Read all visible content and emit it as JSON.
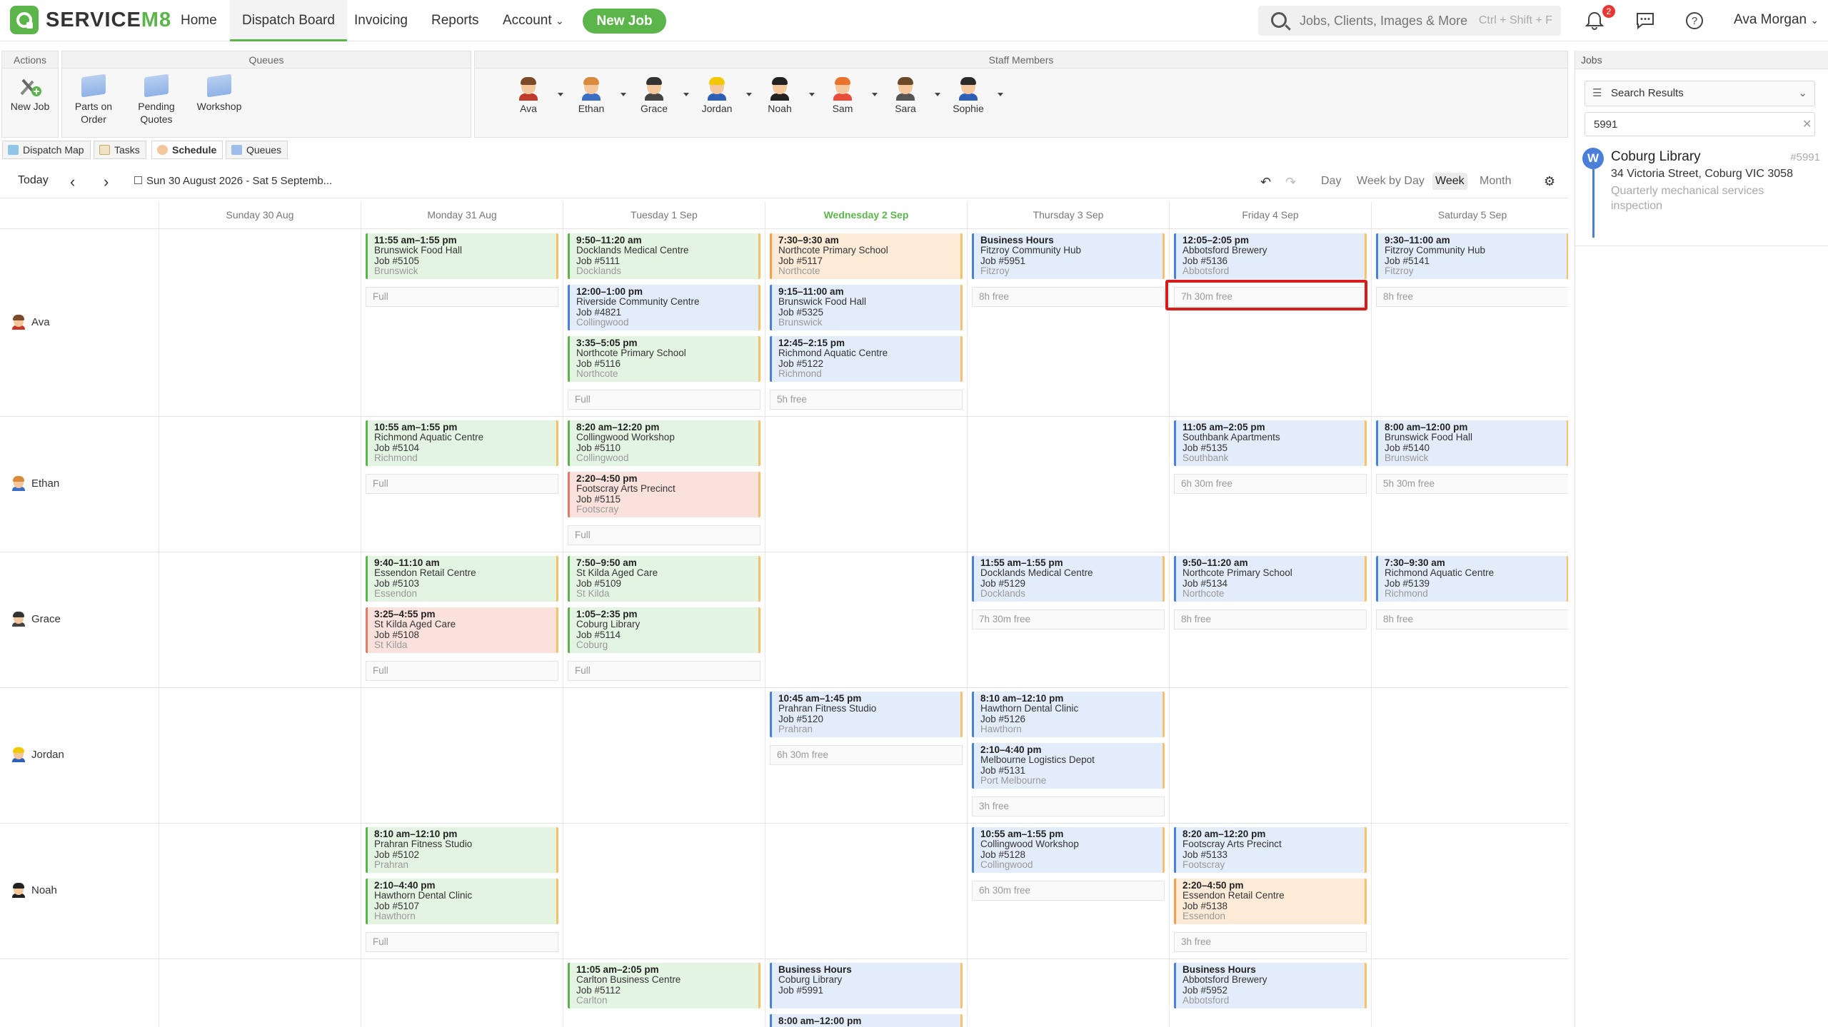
{
  "nav": {
    "brand": "SERVICE",
    "brand_suffix": "M8",
    "home": "Home",
    "dispatch_board": "Dispatch Board",
    "invoicing": "Invoicing",
    "reports": "Reports",
    "account": "Account",
    "new_job": "New Job",
    "search_placeholder": "Jobs, Clients, Images & More",
    "search_shortcut": "Ctrl + Shift + F",
    "notification_count": "2",
    "user_name": "Ava Morgan"
  },
  "toolbar": {
    "actions_title": "Actions",
    "new_job": "New Job",
    "queues_title": "Queues",
    "queues": [
      "Parts on Order",
      "Pending Quotes",
      "Workshop"
    ],
    "staff_title": "Staff Members",
    "staff": [
      "Ava",
      "Ethan",
      "Grace",
      "Jordan",
      "Noah",
      "Sam",
      "Sara",
      "Sophie"
    ]
  },
  "tabs": [
    "Dispatch Map",
    "Tasks",
    "Schedule",
    "Queues"
  ],
  "schedule": {
    "today": "Today",
    "date_range": "Sun 30 August 2026 - Sat 5 Septemb...",
    "views": [
      "Day",
      "Week by Day",
      "Week",
      "Month"
    ],
    "active_view": "Week",
    "days": [
      "Sunday 30 Aug",
      "Monday 31 Aug",
      "Tuesday 1 Sep",
      "Wednesday 2 Sep",
      "Thursday 3 Sep",
      "Friday 4 Sep",
      "Saturday 5 Sep"
    ],
    "today_index": 3,
    "rows": [
      {
        "name": "Ava",
        "cells": [
          {
            "day": 1,
            "jobs": [
              {
                "time": "11:55 am–1:55 pm",
                "client": "Brunswick Food Hall",
                "job": "Job #5105",
                "suburb": "Brunswick",
                "color": "green"
              }
            ],
            "free": "Full"
          },
          {
            "day": 2,
            "jobs": [
              {
                "time": "9:50–11:20 am",
                "client": "Docklands Medical Centre",
                "job": "Job #5111",
                "suburb": "Docklands",
                "color": "green"
              },
              {
                "time": "12:00–1:00 pm",
                "client": "Riverside Community Centre",
                "job": "Job #4821",
                "suburb": "Collingwood",
                "color": "blue"
              },
              {
                "time": "3:35–5:05 pm",
                "client": "Northcote Primary School",
                "job": "Job #5116",
                "suburb": "Northcote",
                "color": "green"
              }
            ],
            "free": "Full"
          },
          {
            "day": 3,
            "jobs": [
              {
                "time": "7:30–9:30 am",
                "client": "Northcote Primary School",
                "job": "Job #5117",
                "suburb": "Northcote",
                "color": "orange"
              },
              {
                "time": "9:15–11:00 am",
                "client": "Brunswick Food Hall",
                "job": "Job #5325",
                "suburb": "Brunswick",
                "color": "blue"
              },
              {
                "time": "12:45–2:15 pm",
                "client": "Richmond Aquatic Centre",
                "job": "Job #5122",
                "suburb": "Richmond",
                "color": "blue"
              }
            ],
            "free": "5h free"
          },
          {
            "day": 4,
            "jobs": [
              {
                "time": "Business Hours",
                "client": "Fitzroy Community Hub",
                "job": "Job #5951",
                "suburb": "Fitzroy",
                "color": "blue"
              }
            ],
            "free": "8h free"
          },
          {
            "day": 5,
            "jobs": [
              {
                "time": "12:05–2:05 pm",
                "client": "Abbotsford Brewery",
                "job": "Job #5136",
                "suburb": "Abbotsford",
                "color": "blue"
              }
            ],
            "free": "7h 30m free"
          },
          {
            "day": 6,
            "jobs": [
              {
                "time": "9:30–11:00 am",
                "client": "Fitzroy Community Hub",
                "job": "Job #5141",
                "suburb": "Fitzroy",
                "color": "blue"
              }
            ],
            "free": "8h free"
          }
        ]
      },
      {
        "name": "Ethan",
        "cells": [
          {
            "day": 1,
            "jobs": [
              {
                "time": "10:55 am–1:55 pm",
                "client": "Richmond Aquatic Centre",
                "job": "Job #5104",
                "suburb": "Richmond",
                "color": "green"
              }
            ],
            "free": "Full"
          },
          {
            "day": 2,
            "jobs": [
              {
                "time": "8:20 am–12:20 pm",
                "client": "Collingwood Workshop",
                "job": "Job #5110",
                "suburb": "Collingwood",
                "color": "green"
              },
              {
                "time": "2:20–4:50 pm",
                "client": "Footscray Arts Precinct",
                "job": "Job #5115",
                "suburb": "Footscray",
                "color": "red"
              }
            ],
            "free": "Full"
          },
          {
            "day": 5,
            "jobs": [
              {
                "time": "11:05 am–2:05 pm",
                "client": "Southbank Apartments",
                "job": "Job #5135",
                "suburb": "Southbank",
                "color": "blue"
              }
            ],
            "free": "6h 30m free"
          },
          {
            "day": 6,
            "jobs": [
              {
                "time": "8:00 am–12:00 pm",
                "client": "Brunswick Food Hall",
                "job": "Job #5140",
                "suburb": "Brunswick",
                "color": "blue"
              }
            ],
            "free": "5h 30m free"
          }
        ]
      },
      {
        "name": "Grace",
        "cells": [
          {
            "day": 1,
            "jobs": [
              {
                "time": "9:40–11:10 am",
                "client": "Essendon Retail Centre",
                "job": "Job #5103",
                "suburb": "Essendon",
                "color": "green"
              },
              {
                "time": "3:25–4:55 pm",
                "client": "St Kilda Aged Care",
                "job": "Job #5108",
                "suburb": "St Kilda",
                "color": "red"
              }
            ],
            "free": "Full"
          },
          {
            "day": 2,
            "jobs": [
              {
                "time": "7:50–9:50 am",
                "client": "St Kilda Aged Care",
                "job": "Job #5109",
                "suburb": "St Kilda",
                "color": "green"
              },
              {
                "time": "1:05–2:35 pm",
                "client": "Coburg Library",
                "job": "Job #5114",
                "suburb": "Coburg",
                "color": "green"
              }
            ],
            "free": "Full"
          },
          {
            "day": 4,
            "jobs": [
              {
                "time": "11:55 am–1:55 pm",
                "client": "Docklands Medical Centre",
                "job": "Job #5129",
                "suburb": "Docklands",
                "color": "blue"
              }
            ],
            "free": "7h 30m free"
          },
          {
            "day": 5,
            "jobs": [
              {
                "time": "9:50–11:20 am",
                "client": "Northcote Primary School",
                "job": "Job #5134",
                "suburb": "Northcote",
                "color": "blue"
              }
            ],
            "free": "8h free"
          },
          {
            "day": 6,
            "jobs": [
              {
                "time": "7:30–9:30 am",
                "client": "Richmond Aquatic Centre",
                "job": "Job #5139",
                "suburb": "Richmond",
                "color": "blue"
              }
            ],
            "free": "8h free"
          }
        ]
      },
      {
        "name": "Jordan",
        "cells": [
          {
            "day": 3,
            "jobs": [
              {
                "time": "10:45 am–1:45 pm",
                "client": "Prahran Fitness Studio",
                "job": "Job #5120",
                "suburb": "Prahran",
                "color": "blue"
              }
            ],
            "free": "6h 30m free"
          },
          {
            "day": 4,
            "jobs": [
              {
                "time": "8:10 am–12:10 pm",
                "client": "Hawthorn Dental Clinic",
                "job": "Job #5126",
                "suburb": "Hawthorn",
                "color": "blue"
              },
              {
                "time": "2:10–4:40 pm",
                "client": "Melbourne Logistics Depot",
                "job": "Job #5131",
                "suburb": "Port Melbourne",
                "color": "blue"
              }
            ],
            "free": "3h free"
          }
        ]
      },
      {
        "name": "Noah",
        "cells": [
          {
            "day": 1,
            "jobs": [
              {
                "time": "8:10 am–12:10 pm",
                "client": "Prahran Fitness Studio",
                "job": "Job #5102",
                "suburb": "Prahran",
                "color": "green"
              },
              {
                "time": "2:10–4:40 pm",
                "client": "Hawthorn Dental Clinic",
                "job": "Job #5107",
                "suburb": "Hawthorn",
                "color": "green"
              }
            ],
            "free": "Full"
          },
          {
            "day": 4,
            "jobs": [
              {
                "time": "10:55 am–1:55 pm",
                "client": "Collingwood Workshop",
                "job": "Job #5128",
                "suburb": "Collingwood",
                "color": "blue"
              }
            ],
            "free": "6h 30m free"
          },
          {
            "day": 5,
            "jobs": [
              {
                "time": "8:20 am–12:20 pm",
                "client": "Footscray Arts Precinct",
                "job": "Job #5133",
                "suburb": "Footscray",
                "color": "blue"
              },
              {
                "time": "2:20–4:50 pm",
                "client": "Essendon Retail Centre",
                "job": "Job #5138",
                "suburb": "Essendon",
                "color": "orange"
              }
            ],
            "free": "3h free"
          }
        ]
      },
      {
        "name": "",
        "cells": [
          {
            "day": 2,
            "jobs": [
              {
                "time": "11:05 am–2:05 pm",
                "client": "Carlton Business Centre",
                "job": "Job #5112",
                "suburb": "Carlton",
                "color": "green"
              }
            ],
            "free": ""
          },
          {
            "day": 3,
            "jobs": [
              {
                "time": "Business Hours",
                "client": "Coburg Library",
                "job": "Job #5991",
                "suburb": "",
                "color": "blue"
              },
              {
                "time": "8:00 am–12:00 pm",
                "client": "",
                "job": "",
                "suburb": "",
                "color": "blue"
              }
            ],
            "free": ""
          },
          {
            "day": 5,
            "jobs": [
              {
                "time": "Business Hours",
                "client": "Abbotsford Brewery",
                "job": "Job #5952",
                "suburb": "Abbotsford",
                "color": "blue"
              }
            ],
            "free": ""
          }
        ]
      }
    ]
  },
  "jobs_panel": {
    "title": "Jobs",
    "filter": "Search Results",
    "search_value": "5991",
    "result": {
      "avatar": "W",
      "name": "Coburg Library",
      "number": "#5991",
      "address": "34 Victoria Street, Coburg VIC 3058",
      "description": "Quarterly mechanical services inspection"
    }
  },
  "colors": {
    "brand_green": "#5cb54a",
    "job_blue": "#4a80d8",
    "highlight_red": "#d81b1b"
  }
}
